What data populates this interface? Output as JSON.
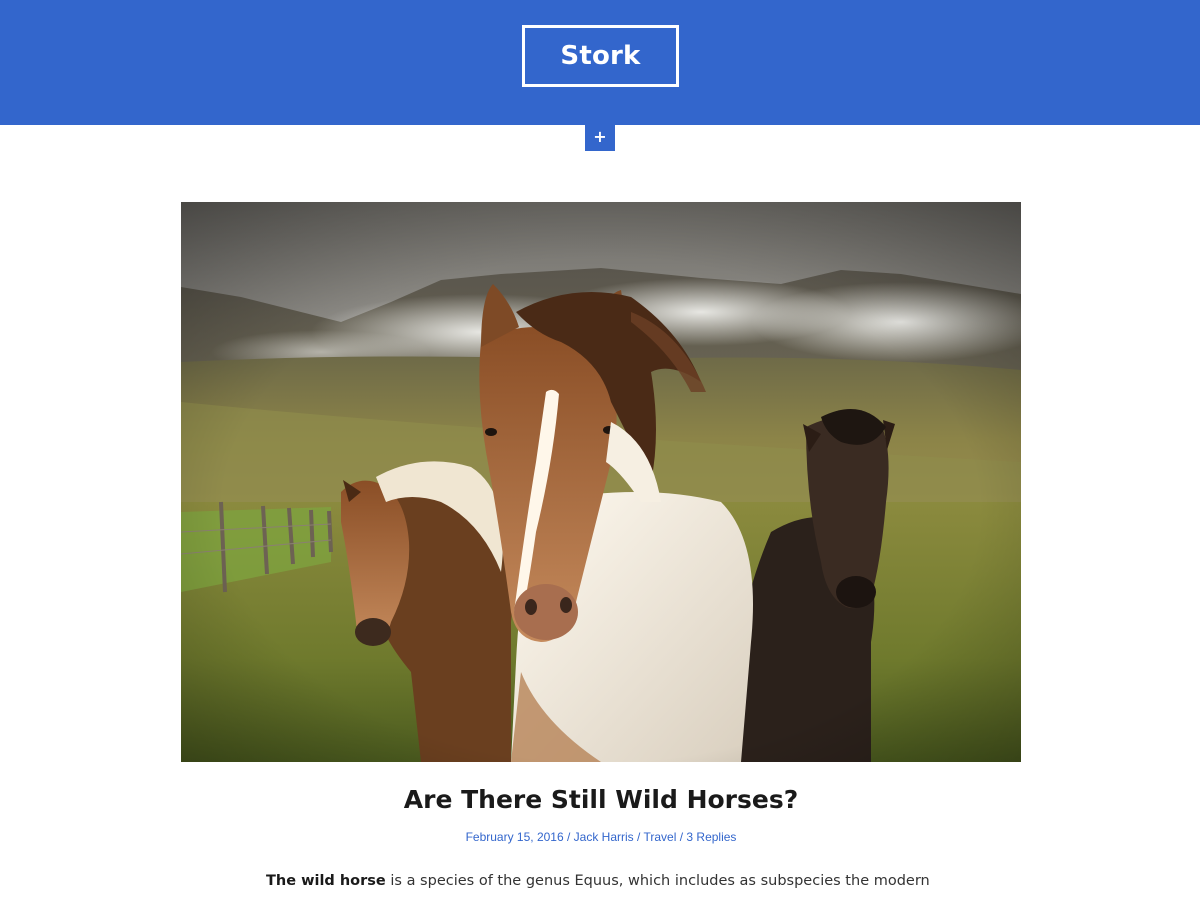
{
  "site": {
    "title": "Stork",
    "menu_toggle": "+"
  },
  "colors": {
    "brand": "#3366cc",
    "text": "#1a1a1a",
    "body_text": "#333333"
  },
  "post": {
    "image": "featured-image",
    "title": "Are There Still Wild Horses?",
    "meta": {
      "date": "February 15, 2016",
      "author": "Jack Harris",
      "category": "Travel",
      "comments": "3 Replies",
      "separator": "/"
    },
    "excerpt": {
      "lead": "The wild horse",
      "rest": " is a species of the genus Equus, which includes as subspecies the modern"
    }
  }
}
